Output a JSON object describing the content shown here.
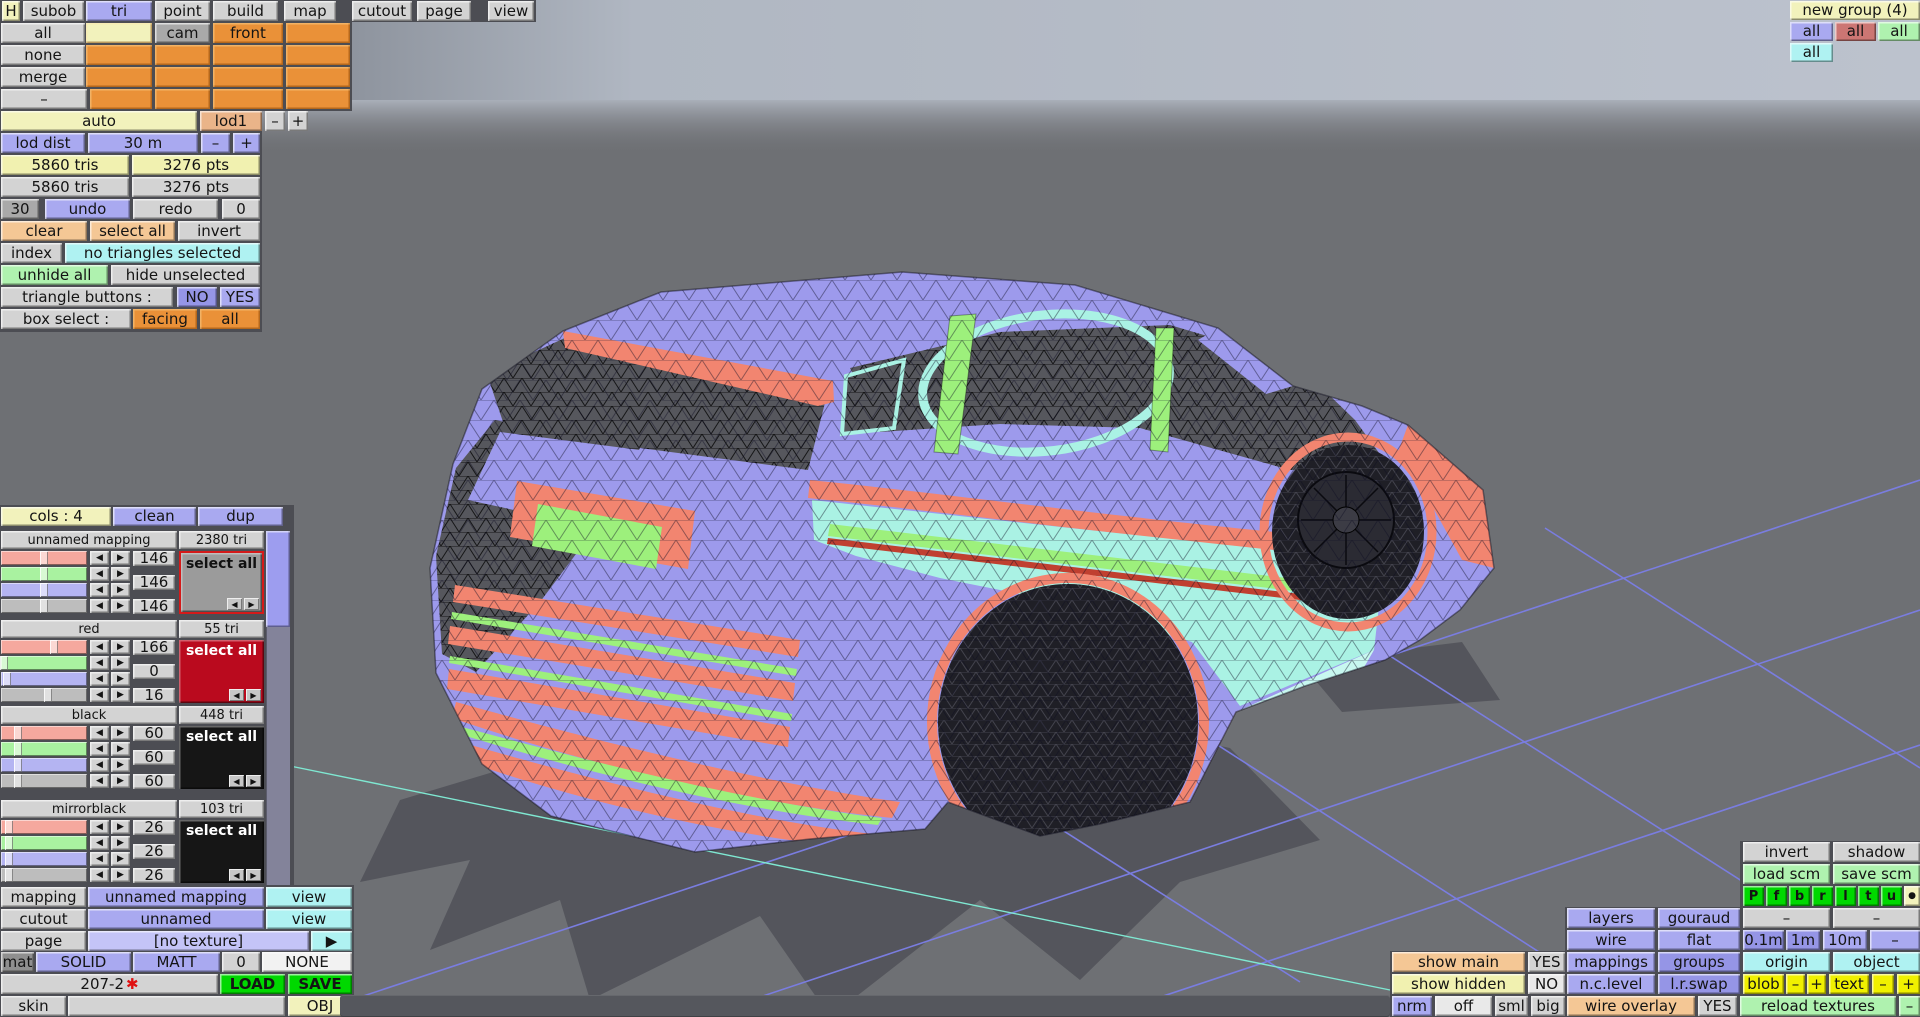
{
  "colors": {
    "viewport_bg": "#6e7074",
    "body_lavender": "#9d9aec",
    "salmon": "#f28570",
    "cyan": "#aaf2e4",
    "green": "#9df07c",
    "grid_purple": "#7a7de0",
    "grid_cyan": "#7fe8d2",
    "accent_purple": "#a9a9f0",
    "orange": "#ea9138",
    "bright_green": "#00d800"
  },
  "icons": {
    "left": "◀",
    "right": "▶",
    "play": "▶",
    "dot": "●",
    "asterisk": "✱"
  },
  "menu": {
    "items": [
      "H",
      "subob",
      "tri",
      "point",
      "build",
      "map",
      "cutout",
      "page",
      "view"
    ]
  },
  "top_left": {
    "all": "all",
    "none": "none",
    "merge": "merge",
    "dash": "–",
    "cam": "cam",
    "front": "front",
    "auto": "auto",
    "lod1": "lod1",
    "minus": "–",
    "plus": "+",
    "lod_dist": "lod dist",
    "lod_dist_value": "30 m",
    "tris_active": "5860 tris",
    "pts_active": "3276 pts",
    "tris_total": "5860 tris",
    "pts_total": "3276 pts",
    "undo_steps": "30",
    "undo": "undo",
    "redo": "redo",
    "redo_steps": "0",
    "clear": "clear",
    "select_all": "select all",
    "invert": "invert",
    "index": "index",
    "selection_status": "no triangles selected",
    "unhide_all": "unhide all",
    "hide_unselected": "hide unselected",
    "triangle_buttons": "triangle buttons :",
    "no": "NO",
    "yes": "YES",
    "box_select": "box select :",
    "facing": "facing",
    "box_all": "all"
  },
  "mat_panel": {
    "cols": "cols : 4",
    "clean": "clean",
    "dup": "dup",
    "groups": [
      {
        "name": "unnamed mapping",
        "tri": "2380 tri",
        "v1": "146",
        "v2": "146",
        "v3": "146",
        "select": "select all",
        "pct": [
          50,
          50,
          50,
          50
        ]
      },
      {
        "name": "red",
        "tri": "55 tri",
        "v1": "166",
        "v2": "0",
        "v3": "16",
        "select": "select all",
        "pct": [
          62,
          3,
          7,
          55
        ]
      },
      {
        "name": "black",
        "tri": "448 tri",
        "v1": "60",
        "v2": "60",
        "v3": "60",
        "select": "select all",
        "pct": [
          20,
          20,
          20,
          20
        ]
      },
      {
        "name": "mirrorblack",
        "tri": "103 tri",
        "v1": "26",
        "v2": "26",
        "v3": "26",
        "select": "select all",
        "pct": [
          9,
          9,
          9,
          9
        ]
      }
    ]
  },
  "bottom_left": {
    "mapping": "mapping",
    "mapping_value": "unnamed mapping",
    "view1": "view",
    "cutout": "cutout",
    "cutout_value": "unnamed",
    "view2": "view",
    "page": "page",
    "page_value": "[no texture]",
    "mat": "mat",
    "solid": "SOLID",
    "matt": "MATT",
    "zero": "0",
    "none_opt": "NONE",
    "file_name": "207-2",
    "load": "LOAD",
    "save": "SAVE",
    "skin": "skin",
    "skin_value": "",
    "obj": "OBJ"
  },
  "top_right": {
    "new_group": "new group (4)",
    "all_purple": "all",
    "all_red": "all",
    "all_green": "all",
    "all_cyan": "all"
  },
  "bottom_right": {
    "invert": "invert",
    "shadow": "shadow",
    "load_scm": "load scm",
    "save_scm": "save scm",
    "axis_p": "P",
    "axis_f": "f",
    "axis_b": "b",
    "axis_r": "r",
    "axis_l": "l",
    "axis_t": "t",
    "axis_u": "u",
    "layers": "layers",
    "gouraud": "gouraud",
    "dash1": "–",
    "dash2": "–",
    "wire": "wire",
    "flat": "flat",
    "m01": "0.1m",
    "m1": "1m",
    "m10": "10m",
    "dash3": "–",
    "show_main": "show main",
    "show_main_val": "YES",
    "mappings": "mappings",
    "groups": "groups",
    "origin": "origin",
    "object": "object",
    "show_hidden": "show hidden",
    "show_hidden_val": "NO",
    "nclevel": "n.c.level",
    "lrswap": "l.r.swap",
    "blob": "blob",
    "blob_minus": "–",
    "blob_plus": "+",
    "text": "text",
    "text_minus": "–",
    "text_plus": "+",
    "nrm": "nrm",
    "off": "off",
    "sml": "sml",
    "big": "big",
    "wire_overlay": "wire overlay",
    "wire_overlay_val": "YES",
    "reload_textures": "reload textures",
    "dash4": "–"
  }
}
